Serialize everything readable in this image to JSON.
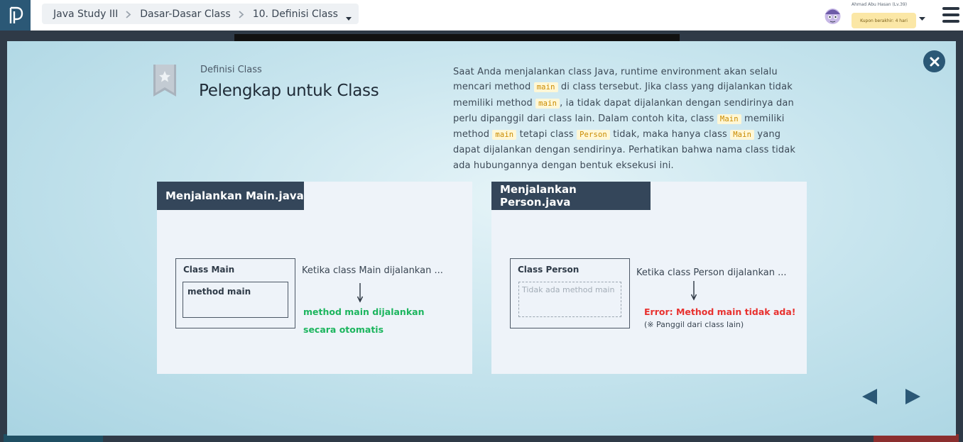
{
  "header": {
    "logo_icon": "progate-logo-icon",
    "breadcrumb": [
      "Java Study III",
      "Dasar-Dasar Class",
      "10. Definisi Class"
    ],
    "user_name": "Ahmad Abu Hasan (Lv.39)",
    "coupon": "Kupon berakhir: 4 hari"
  },
  "lesson": {
    "subtitle": "Definisi Class",
    "title": "Pelengkap untuk Class",
    "desc": {
      "t1": "Saat Anda menjalankan class Java, runtime environment akan selalu mencari method ",
      "c1": "main",
      "t2": " di class tersebut. Jika class yang dijalankan tidak memiliki method ",
      "c2": "main",
      "t3": ", ia tidak dapat dijalankan dengan sendirinya dan perlu dipanggil dari class lain. Dalam contoh kita, class ",
      "c3": "Main",
      "t4": " memiliki method ",
      "c4": "main",
      "t5": " tetapi class ",
      "c5": "Person",
      "t6": " tidak, maka hanya class ",
      "c6": "Main",
      "t7": " yang dapat dijalankan dengan sendirinya. Perhatikan bahwa nama class tidak ada hubungannya dengan bentuk eksekusi ini."
    }
  },
  "panels": [
    {
      "header": "Menjalankan Main.java",
      "class_label": "Class Main",
      "inner_label": "method main",
      "note": "Ketika class Main dijalankan ...",
      "result_line1": "method main dijalankan",
      "result_line2": "secara otomatis"
    },
    {
      "header": "Menjalankan Person.java",
      "class_label": "Class Person",
      "inner_label": "Tidak ada method main",
      "note": "Ketika class Person dijalankan ...",
      "result_line1": "Error: Method main tidak ada!",
      "result_line2": "(※ Panggil dari class lain)"
    }
  ],
  "colors": {
    "navy": "#2b5876",
    "panel_header": "#34465a",
    "success": "#1cb55e",
    "error": "#e8312f",
    "code": "#c98b00"
  }
}
